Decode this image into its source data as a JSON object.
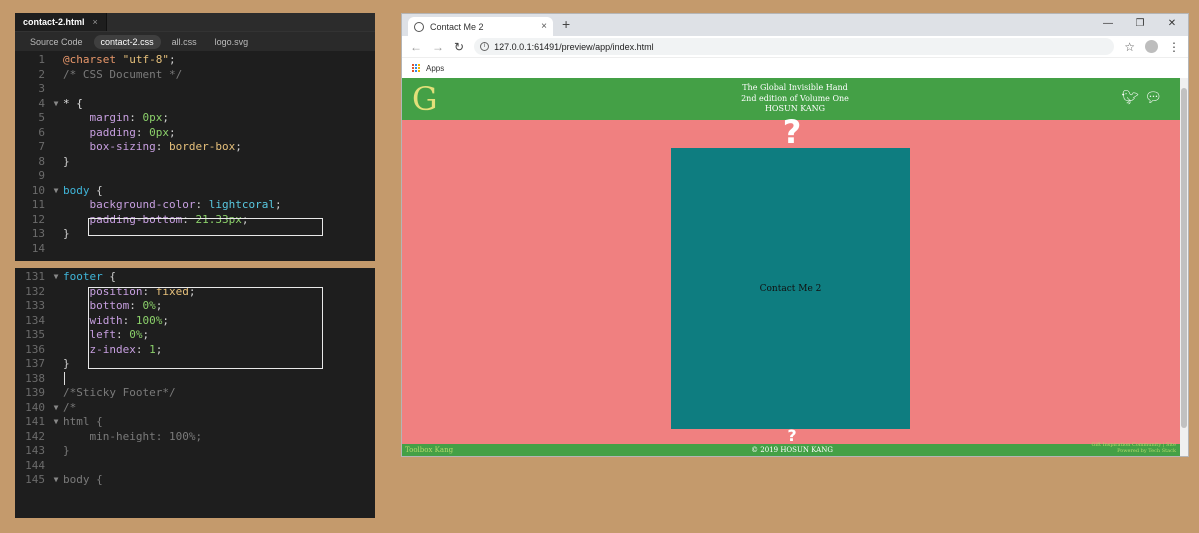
{
  "editor": {
    "file_tab": "contact-2.html",
    "file_tab_close": "×",
    "related_files": [
      "Source Code",
      "contact-2.css",
      "all.css",
      "logo.svg"
    ],
    "active_related": 1,
    "top_lines": [
      {
        "n": "1",
        "f": "",
        "html": "<span class='at'>@charset</span> <span class='str'>\"utf-8\"</span>;"
      },
      {
        "n": "2",
        "f": "",
        "html": "<span class='cm'>/* CSS Document */</span>"
      },
      {
        "n": "3",
        "f": "",
        "html": ""
      },
      {
        "n": "4",
        "f": "▼",
        "html": "<span class='sel'>* {</span>"
      },
      {
        "n": "5",
        "f": "",
        "html": "    <span class='prop'>margin</span>: <span class='num'>0px</span>;"
      },
      {
        "n": "6",
        "f": "",
        "html": "    <span class='prop'>padding</span>: <span class='num'>0px</span>;"
      },
      {
        "n": "7",
        "f": "",
        "html": "    <span class='prop'>box-sizing</span>: <span class='kw'>border-box</span>;"
      },
      {
        "n": "8",
        "f": "",
        "html": "}"
      },
      {
        "n": "9",
        "f": "",
        "html": ""
      },
      {
        "n": "10",
        "f": "▼",
        "html": "<span class='tag'>body</span> {"
      },
      {
        "n": "11",
        "f": "",
        "html": "    <span class='prop'>background-color</span>: <span class='val'>lightcoral</span>;"
      },
      {
        "n": "12",
        "f": "",
        "html": "    <span class='prop'>padding-bottom</span>: <span class='num'>21.33px</span>;"
      },
      {
        "n": "13",
        "f": "",
        "html": "}"
      },
      {
        "n": "14",
        "f": "",
        "html": ""
      }
    ],
    "bottom_lines": [
      {
        "n": "131",
        "f": "▼",
        "html": "<span class='tag'>footer</span> {"
      },
      {
        "n": "132",
        "f": "",
        "html": "    <span class='prop'>position</span>: <span class='kw'>fixed</span>;"
      },
      {
        "n": "133",
        "f": "",
        "html": "    <span class='prop'>bottom</span>: <span class='num'>0%</span>;"
      },
      {
        "n": "134",
        "f": "",
        "html": "    <span class='prop'>width</span>: <span class='num'>100%</span>;"
      },
      {
        "n": "135",
        "f": "",
        "html": "    <span class='prop'>left</span>: <span class='num'>0%</span>;"
      },
      {
        "n": "136",
        "f": "",
        "html": "    <span class='prop'>z-index</span>: <span class='num'>1</span>;"
      },
      {
        "n": "137",
        "f": "",
        "html": "}"
      },
      {
        "n": "138",
        "f": "",
        "html": "<span class='cursor'></span>"
      },
      {
        "n": "139",
        "f": "",
        "html": "<span class='cm'>/*Sticky Footer*/</span>"
      },
      {
        "n": "140",
        "f": "▼",
        "html": "<span class='cm'>/*</span>"
      },
      {
        "n": "141",
        "f": "▼",
        "html": "<span class='cm'>html {</span>"
      },
      {
        "n": "142",
        "f": "",
        "html": "<span class='cm'>    min-height: 100%;</span>"
      },
      {
        "n": "143",
        "f": "",
        "html": "<span class='cm'>}</span>"
      },
      {
        "n": "144",
        "f": "",
        "html": ""
      },
      {
        "n": "145",
        "f": "▼",
        "html": "<span class='cm'>body {</span>"
      }
    ]
  },
  "browser": {
    "tab_title": "Contact Me 2",
    "tab_close": "×",
    "new_tab": "+",
    "window_controls": [
      "—",
      "❐",
      "✕"
    ],
    "url": "127.0.0.1:61491/preview/app/index.html",
    "bookmarks_label": "Apps",
    "page": {
      "logo_letter": "G",
      "header_lines": [
        "The Global Invisible Hand",
        "2nd edition of Volume One",
        "HOSUN KANG"
      ],
      "question_mark": "?",
      "box_text": "Contact Me 2",
      "footer_left": "Toolbox Kang",
      "footer_center": "© 2019 HOSUN KANG",
      "footer_right": [
        "Gift Inspiration Community | Site",
        "Powered by Tech Stack"
      ]
    }
  }
}
